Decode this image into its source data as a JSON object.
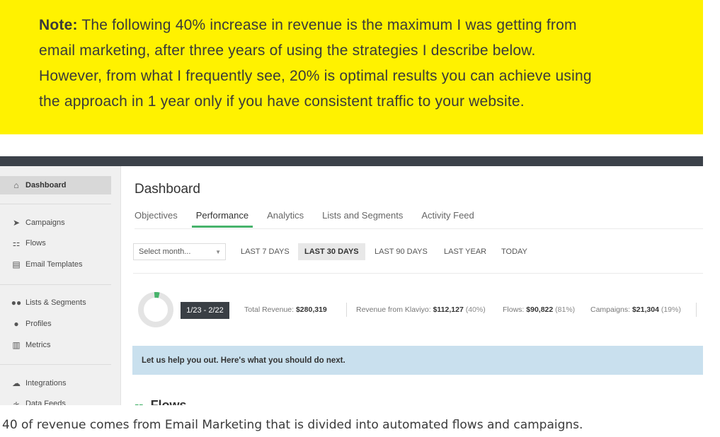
{
  "note": {
    "label": "Note:",
    "line1": "The following 40% increase in revenue is the maximum I was getting from",
    "line2": "email marketing, after three years of using the strategies I describe below.",
    "line3": "However, from what I frequently see, 20% is optimal results you can achieve using",
    "line4": "the approach in 1 year only if you have consistent traffic to your website.",
    "background": "#fff200"
  },
  "sidebar": {
    "items": [
      {
        "label": "Dashboard",
        "icon": "home-icon",
        "active": true
      },
      {
        "label": "Campaigns",
        "icon": "paper-plane-icon"
      },
      {
        "label": "Flows",
        "icon": "flows-icon"
      },
      {
        "label": "Email Templates",
        "icon": "template-icon"
      },
      {
        "label": "Lists & Segments",
        "icon": "users-icon"
      },
      {
        "label": "Profiles",
        "icon": "user-icon"
      },
      {
        "label": "Metrics",
        "icon": "bar-chart-icon"
      },
      {
        "label": "Integrations",
        "icon": "cloud-icon"
      },
      {
        "label": "Data Feeds",
        "icon": "rss-icon"
      }
    ]
  },
  "dashboard": {
    "title": "Dashboard",
    "tabs": [
      {
        "label": "Objectives"
      },
      {
        "label": "Performance",
        "active": true
      },
      {
        "label": "Analytics"
      },
      {
        "label": "Lists and Segments"
      },
      {
        "label": "Activity Feed"
      }
    ],
    "select_month": "Select month...",
    "ranges": [
      {
        "label": "LAST 7 DAYS"
      },
      {
        "label": "LAST 30 DAYS",
        "active": true
      },
      {
        "label": "LAST 90 DAYS"
      },
      {
        "label": "LAST YEAR"
      },
      {
        "label": "TODAY"
      }
    ],
    "date_range": "1/23 - 2/22",
    "stats": {
      "total_revenue_label": "Total Revenue:",
      "total_revenue_value": "$280,319",
      "klaviyo_label": "Revenue from Klaviyo:",
      "klaviyo_value": "$112,127",
      "klaviyo_pct": "(40%)",
      "flows_label": "Flows:",
      "flows_value": "$90,822",
      "flows_pct": "(81%)",
      "campaigns_label": "Campaigns:",
      "campaigns_value": "$21,304",
      "campaigns_pct": "(19%)"
    },
    "donut_fraction": 0.05,
    "help_text": "Let us help you out. Here's what you should do next.",
    "flows_heading": "Flows",
    "accent": "#47b36b"
  },
  "caption": "40 of revenue comes from Email Marketing that is divided into automated flows and campaigns."
}
